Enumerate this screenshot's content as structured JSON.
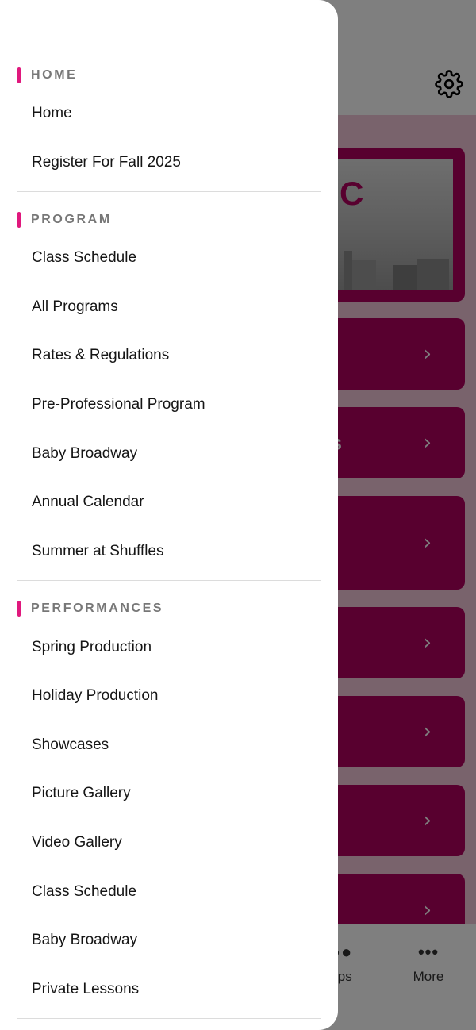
{
  "drawer": {
    "sections": [
      {
        "title": "HOME",
        "items": [
          "Home",
          "Register For Fall 2025"
        ]
      },
      {
        "title": "PROGRAM",
        "items": [
          "Class Schedule",
          "All Programs",
          "Rates & Regulations",
          "Pre-Professional Program",
          "Baby Broadway",
          "Annual Calendar",
          "Summer at Shuffles"
        ]
      },
      {
        "title": "PERFORMANCES",
        "items": [
          "Spring Production",
          "Holiday Production",
          "Showcases",
          "Picture Gallery",
          "Video Gallery",
          "Class Schedule",
          "Baby Broadway",
          "Private Lessons"
        ]
      }
    ]
  },
  "background": {
    "hero_partial_text": "C",
    "card_partial_text": "es",
    "tabs": [
      {
        "label": "ups",
        "icon": "groups-icon"
      },
      {
        "label": "More",
        "icon": "more-icon"
      }
    ]
  },
  "colors": {
    "accent": "#e0187d",
    "brand": "#b0005f"
  }
}
